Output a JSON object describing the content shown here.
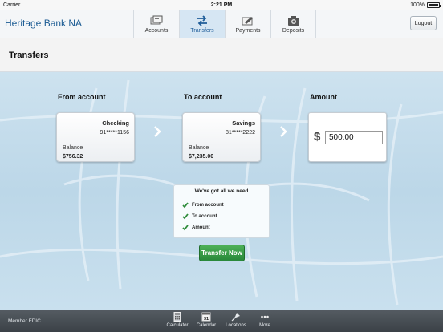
{
  "status_bar": {
    "carrier": "Carrier",
    "time": "2:21 PM",
    "battery": "100%"
  },
  "header": {
    "bank_name": "Heritage Bank NA",
    "tabs": [
      {
        "label": "Accounts",
        "icon": "accounts-icon"
      },
      {
        "label": "Transfers",
        "icon": "transfers-icon",
        "active": true
      },
      {
        "label": "Payments",
        "icon": "payments-icon"
      },
      {
        "label": "Deposits",
        "icon": "camera-icon"
      }
    ],
    "logout_label": "Logout"
  },
  "page": {
    "title": "Transfers"
  },
  "from_account": {
    "heading": "From account",
    "name": "Checking",
    "number": "91*****1156",
    "balance_label": "Balance",
    "balance": "$756.32"
  },
  "to_account": {
    "heading": "To account",
    "name": "Savings",
    "number": "81*****2222",
    "balance_label": "Balance",
    "balance": "$7,235.00"
  },
  "amount": {
    "heading": "Amount",
    "currency": "$",
    "value": "500.00"
  },
  "checklist": {
    "title": "We've got all we need",
    "items": [
      "From account",
      "To account",
      "Amount"
    ]
  },
  "transfer_button": "Transfer Now",
  "footer": {
    "member": "Member FDIC",
    "tools": [
      {
        "label": "Calculator",
        "icon": "calculator-icon"
      },
      {
        "label": "Calendar",
        "icon": "calendar-icon",
        "badge": "31"
      },
      {
        "label": "Locations",
        "icon": "locations-icon"
      },
      {
        "label": "More",
        "icon": "more-icon"
      }
    ]
  },
  "colors": {
    "accent": "#1b5b93",
    "button_green": "#2e9640",
    "check_green": "#2e8b3a"
  }
}
